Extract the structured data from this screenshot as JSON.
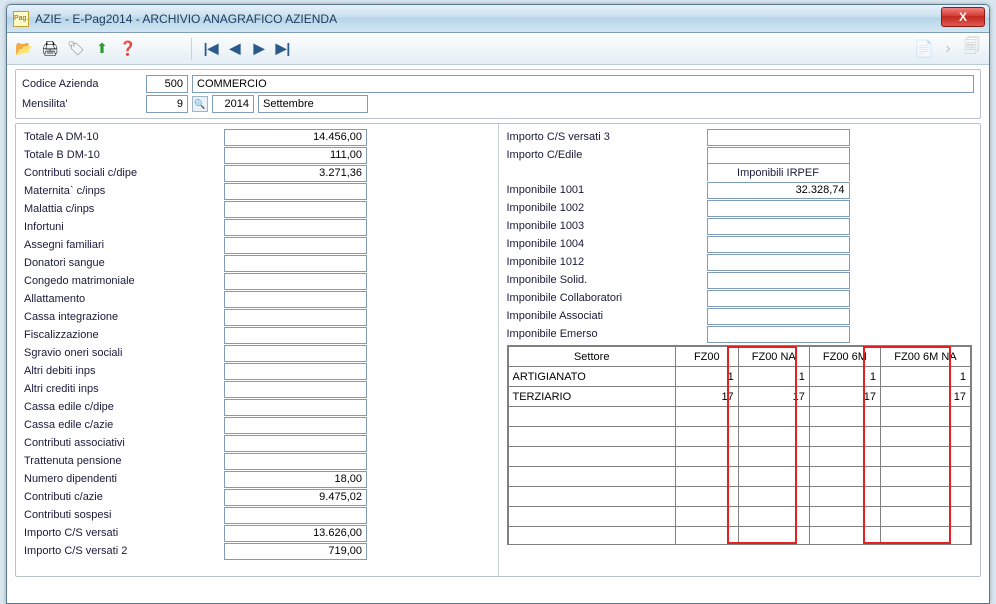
{
  "window": {
    "title": "AZIE  -  E-Pag2014  -   ARCHIVIO ANAGRAFICO AZIENDA",
    "close": "X",
    "appicon": "Pag."
  },
  "toolbar": {
    "icons": {
      "open": "📂",
      "print": "🖨",
      "tag": "🏷",
      "upload": "⬆",
      "help": "❓",
      "first": "|◀",
      "prev": "◀",
      "next": "▶",
      "last": "▶|",
      "doc1": "📄",
      "doc2": "›",
      "doc3": "🗐"
    }
  },
  "header": {
    "codice_label": "Codice Azienda",
    "codice_value": "500",
    "azienda_nome": "COMMERCIO",
    "mensilita_label": "Mensilita'",
    "mensilita_value": "9",
    "anno": "2014",
    "mese": "Settembre"
  },
  "left": [
    {
      "label": "Totale A DM-10",
      "value": "14.456,00"
    },
    {
      "label": "Totale B DM-10",
      "value": "111,00"
    },
    {
      "label": "Contributi sociali c/dipe",
      "value": "3.271,36"
    },
    {
      "label": "Maternita` c/inps",
      "value": ""
    },
    {
      "label": "Malattia  c/inps",
      "value": ""
    },
    {
      "label": "Infortuni",
      "value": ""
    },
    {
      "label": "Assegni familiari",
      "value": ""
    },
    {
      "label": "Donatori sangue",
      "value": ""
    },
    {
      "label": "Congedo matrimoniale",
      "value": ""
    },
    {
      "label": "Allattamento",
      "value": ""
    },
    {
      "label": "Cassa integrazione",
      "value": ""
    },
    {
      "label": "Fiscalizzazione",
      "value": ""
    },
    {
      "label": "Sgravio oneri sociali",
      "value": ""
    },
    {
      "label": "Altri debiti inps",
      "value": ""
    },
    {
      "label": "Altri crediti inps",
      "value": ""
    },
    {
      "label": "Cassa edile c/dipe",
      "value": ""
    },
    {
      "label": "Cassa edile c/azie",
      "value": ""
    },
    {
      "label": "Contributi associativi",
      "value": ""
    },
    {
      "label": "Trattenuta pensione",
      "value": ""
    },
    {
      "label": "Numero dipendenti",
      "value": "18,00"
    },
    {
      "label": "Contributi c/azie",
      "value": "9.475,02"
    },
    {
      "label": "Contributi sospesi",
      "value": ""
    },
    {
      "label": "Importo C/S versati",
      "value": "13.626,00"
    },
    {
      "label": "Importo C/S versati  2",
      "value": "719,00"
    }
  ],
  "right_top": [
    {
      "label": "Importo C/S versati  3",
      "value": ""
    },
    {
      "label": "Importo C/Edile",
      "value": ""
    }
  ],
  "right_head": "Imponibili IRPEF",
  "right_imp": [
    {
      "label": "Imponibile 1001",
      "value": "32.328,74"
    },
    {
      "label": "Imponibile 1002",
      "value": ""
    },
    {
      "label": "Imponibile 1003",
      "value": ""
    },
    {
      "label": "Imponibile 1004",
      "value": ""
    },
    {
      "label": "Imponibile 1012",
      "value": ""
    },
    {
      "label": "Imponibile Solid.",
      "value": ""
    },
    {
      "label": "Imponibile Collaboratori",
      "value": ""
    },
    {
      "label": "Imponibile Associati",
      "value": ""
    },
    {
      "label": "Imponibile Emerso",
      "value": ""
    }
  ],
  "grid": {
    "headers": [
      "Settore",
      "FZ00",
      "FZ00 NA",
      "FZ00 6M",
      "FZ00 6M NA"
    ],
    "rows": [
      {
        "settore": "ARTIGIANATO",
        "fz00": "1",
        "fz00na": "1",
        "fz006m": "1",
        "fz006mna": "1"
      },
      {
        "settore": "TERZIARIO",
        "fz00": "17",
        "fz00na": "17",
        "fz006m": "17",
        "fz006mna": "17"
      },
      {
        "settore": "",
        "fz00": "",
        "fz00na": "",
        "fz006m": "",
        "fz006mna": ""
      },
      {
        "settore": "",
        "fz00": "",
        "fz00na": "",
        "fz006m": "",
        "fz006mna": ""
      },
      {
        "settore": "",
        "fz00": "",
        "fz00na": "",
        "fz006m": "",
        "fz006mna": ""
      },
      {
        "settore": "",
        "fz00": "",
        "fz00na": "",
        "fz006m": "",
        "fz006mna": ""
      },
      {
        "settore": "",
        "fz00": "",
        "fz00na": "",
        "fz006m": "",
        "fz006mna": ""
      },
      {
        "settore": "",
        "fz00": "",
        "fz00na": "",
        "fz006m": "",
        "fz006mna": ""
      },
      {
        "settore": "",
        "fz00": "",
        "fz00na": "",
        "fz006m": "",
        "fz006mna": ""
      }
    ]
  }
}
